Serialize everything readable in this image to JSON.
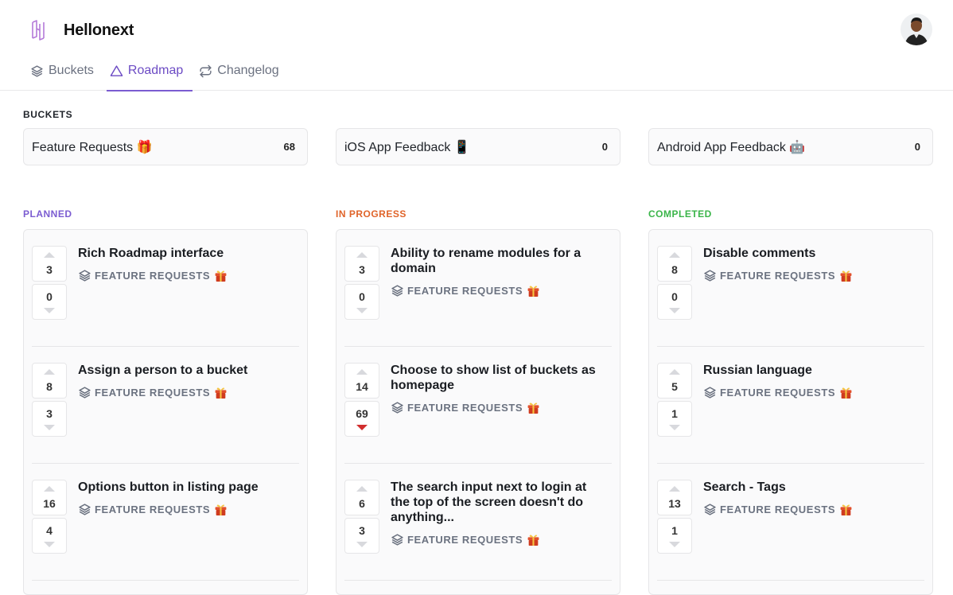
{
  "app": {
    "name": "Hellonext"
  },
  "nav": {
    "tabs": [
      {
        "label": "Buckets",
        "icon": "layers-icon",
        "active": false
      },
      {
        "label": "Roadmap",
        "icon": "triangle-icon",
        "active": true
      },
      {
        "label": "Changelog",
        "icon": "repeat-icon",
        "active": false
      }
    ]
  },
  "buckets": {
    "heading": "BUCKETS",
    "items": [
      {
        "name": "Feature Requests 🎁",
        "count": "68"
      },
      {
        "name": "iOS App Feedback 📱",
        "count": "0"
      },
      {
        "name": "Android App Feedback 🤖",
        "count": "0"
      }
    ]
  },
  "columns": [
    {
      "title": "PLANNED",
      "color": "#7b5cd1",
      "items": [
        {
          "title": "Rich Roadmap interface",
          "tag": "FEATURE REQUESTS",
          "upvotes": "3",
          "downvotes": "0"
        },
        {
          "title": "Assign a person to a bucket",
          "tag": "FEATURE REQUESTS",
          "upvotes": "8",
          "downvotes": "3"
        },
        {
          "title": "Options button in listing page",
          "tag": "FEATURE REQUESTS",
          "upvotes": "16",
          "downvotes": "4"
        }
      ]
    },
    {
      "title": "IN PROGRESS",
      "color": "#e0642a",
      "items": [
        {
          "title": "Ability to rename modules for a domain",
          "tag": "FEATURE REQUESTS",
          "upvotes": "3",
          "downvotes": "0"
        },
        {
          "title": "Choose to show list of buckets as homepage",
          "tag": "FEATURE REQUESTS",
          "upvotes": "14",
          "downvotes": "69",
          "downvoted": true
        },
        {
          "title": "The search input next to login at the top of the screen doesn't do anything...",
          "tag": "FEATURE REQUESTS",
          "upvotes": "6",
          "downvotes": "3"
        }
      ]
    },
    {
      "title": "COMPLETED",
      "color": "#3bb54a",
      "items": [
        {
          "title": "Disable comments",
          "tag": "FEATURE REQUESTS",
          "upvotes": "8",
          "downvotes": "0"
        },
        {
          "title": "Russian language",
          "tag": "FEATURE REQUESTS",
          "upvotes": "5",
          "downvotes": "1"
        },
        {
          "title": "Search - Tags",
          "tag": "FEATURE REQUESTS",
          "upvotes": "13",
          "downvotes": "1"
        }
      ]
    }
  ]
}
